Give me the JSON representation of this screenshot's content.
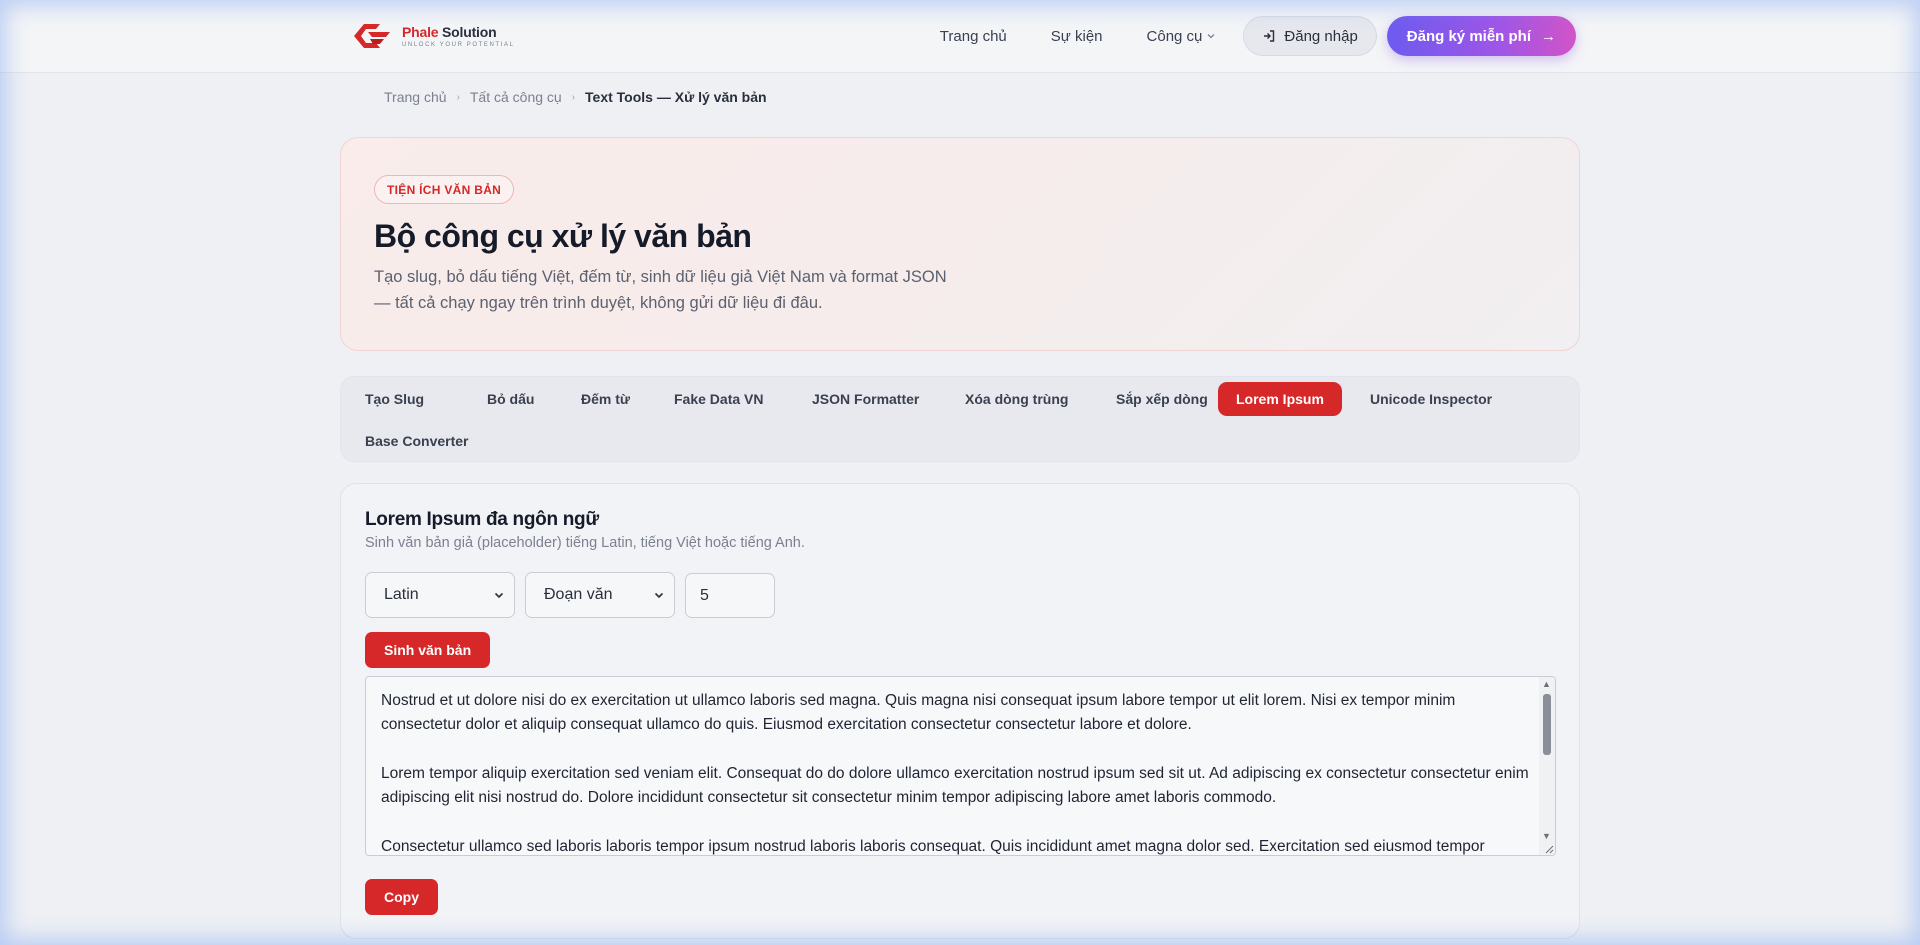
{
  "header": {
    "logo": {
      "brand": "Phale",
      "name": " Solution",
      "tagline": "UNLOCK YOUR POTENTIAL"
    },
    "nav": [
      {
        "label": "Trang chủ"
      },
      {
        "label": "Sự kiện"
      },
      {
        "label": "Công cụ"
      }
    ],
    "login_label": "Đăng nhập",
    "signup_label": "Đăng ký miễn phí",
    "signup_arrow": "→"
  },
  "breadcrumb": {
    "items": [
      "Trang chủ",
      "Tất cả công cụ",
      "Text Tools — Xử lý văn bản"
    ],
    "separator": "›"
  },
  "hero": {
    "badge": "TIỆN ÍCH VĂN BẢN",
    "title": "Bộ công cụ xử lý văn bản",
    "description": "Tạo slug, bỏ dấu tiếng Việt, đếm từ, sinh dữ liệu giả Việt Nam và format JSON — tất cả chạy ngay trên trình duyệt, không gửi dữ liệu đi đâu."
  },
  "tabs": [
    {
      "label": "Tạo Slug"
    },
    {
      "label": "Bỏ dấu"
    },
    {
      "label": "Đếm từ"
    },
    {
      "label": "Fake Data VN"
    },
    {
      "label": "JSON Formatter"
    },
    {
      "label": "Xóa dòng trùng"
    },
    {
      "label": "Sắp xếp dòng"
    },
    {
      "label": "Lorem Ipsum",
      "active": true
    },
    {
      "label": "Unicode Inspector"
    },
    {
      "label": "Base Converter"
    }
  ],
  "panel": {
    "title": "Lorem Ipsum đa ngôn ngữ",
    "subtitle": "Sinh văn bản giả (placeholder) tiếng Latin, tiếng Việt hoặc tiếng Anh.",
    "language_select": "Latin",
    "unit_select": "Đoạn văn",
    "count_value": "5",
    "generate_label": "Sinh văn bản",
    "copy_label": "Copy",
    "output_paragraphs": [
      "Nostrud et ut dolore nisi do ex exercitation ut ullamco laboris sed magna. Quis magna nisi consequat ipsum labore tempor ut elit lorem. Nisi ex tempor minim consectetur dolor et aliquip consequat ullamco do quis. Eiusmod exercitation consectetur consectetur labore et dolore.",
      "Lorem tempor aliquip exercitation sed veniam elit. Consequat do do dolore ullamco exercitation nostrud ipsum sed sit ut. Ad adipiscing ex consectetur consectetur enim adipiscing elit nisi nostrud do. Dolore incididunt consectetur sit consectetur minim tempor adipiscing labore amet laboris commodo.",
      "Consectetur ullamco sed laboris laboris tempor ipsum nostrud laboris laboris consequat. Quis incididunt amet magna dolor sed. Exercitation sed eiusmod tempor labore dolore."
    ]
  },
  "colors": {
    "accent": "#d62828",
    "signup_gradient_start": "#6d5bf0",
    "signup_gradient_end": "#d254c8",
    "page_bg": "#eef0f4"
  },
  "icons": [
    "logo-icon",
    "login-icon",
    "chevron-down-icon",
    "arrow-right-icon"
  ]
}
